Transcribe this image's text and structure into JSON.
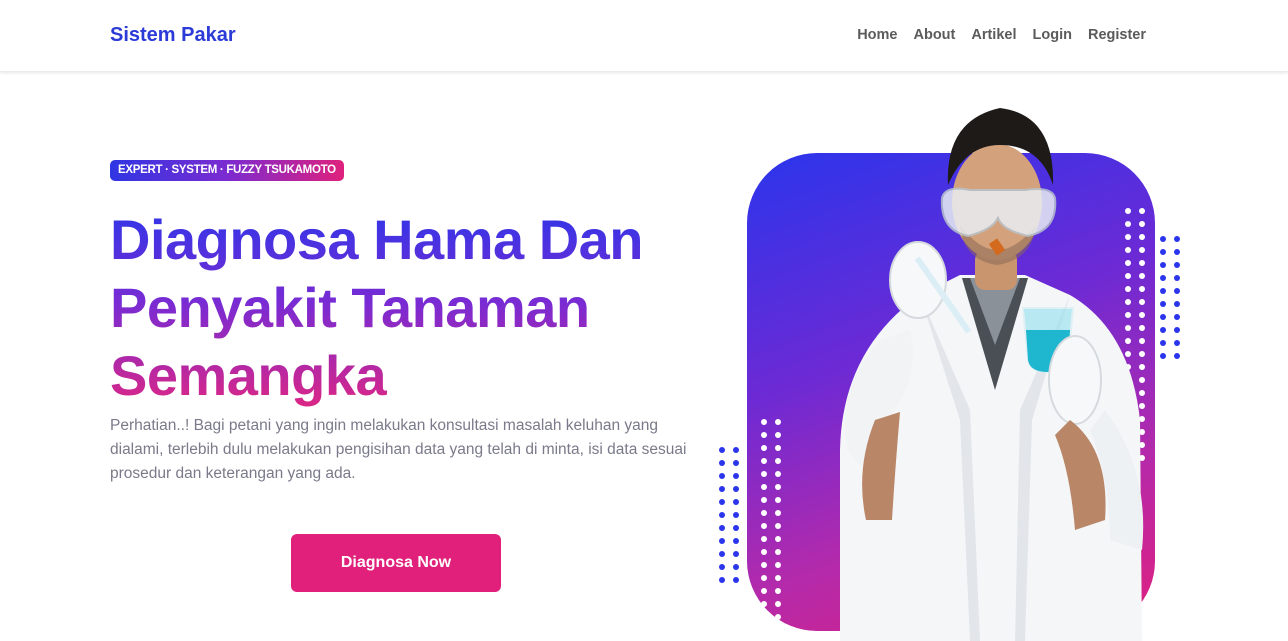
{
  "nav": {
    "brand": "Sistem Pakar",
    "links": [
      {
        "label": "Home"
      },
      {
        "label": "About"
      },
      {
        "label": "Artikel"
      },
      {
        "label": "Login"
      },
      {
        "label": "Register"
      }
    ]
  },
  "hero": {
    "badge": "EXPERT · SYSTEM · FUZZY TSUKAMOTO",
    "title_lines": [
      "Diagnosa Hama Dan",
      "Penyakit Tanaman",
      "Semangka"
    ],
    "description": "Perhatian..! Bagi petani yang ingin melakukan konsultasi masalah keluhan yang dialami, terlebih dulu melakukan pengisihan data yang telah di minta, isi data sesuai prosedur dan keterangan yang ada.",
    "cta_label": "Diagnosa Now",
    "image_alt": "scientist holding test tube and beaker"
  },
  "colors": {
    "brand": "#2c3bd8",
    "gradient_start": "#2e36e8",
    "gradient_mid": "#7a2bd3",
    "gradient_end": "#de2683",
    "cta": "#e0207a"
  }
}
